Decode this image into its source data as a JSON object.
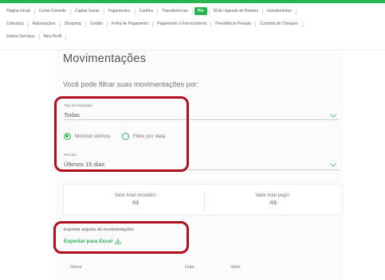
{
  "nav": {
    "row1": [
      "Página Inicial",
      "Conta Corrente",
      "Capital Social",
      "Pagamentos",
      "Cartões",
      "Transferências",
      "Pix",
      "DDA / Agenda de Boletos",
      "Investimentos"
    ],
    "row2": [
      "Cobrança",
      "Autorizações",
      "Shopping",
      "Crédito",
      "Folha de Pagamento",
      "Pagamento a Fornecedores",
      "Previdência Privada",
      "Custódia de Cheques"
    ],
    "row3": [
      "Outros Serviços",
      "Meu Perfil"
    ],
    "active": "Pix"
  },
  "page": {
    "title": "Movimentações",
    "subtitle": "Você pode filtrar suas movimentações por:"
  },
  "filters": {
    "transaction_type_label": "Tipo de transação",
    "transaction_type_value": "Todas",
    "radio_last_label": "Mostrar últimos",
    "radio_date_label": "Filtre por data",
    "radio_selected": "last",
    "period_label": "Período",
    "period_value": "Últimos 15 dias"
  },
  "totals": {
    "received_label": "Valor total recebido:",
    "received_value": "R$",
    "paid_label": "Valor total pago:",
    "paid_value": "-R$"
  },
  "export": {
    "label": "Exportar arquivo de movimentações",
    "link": "Exportar para Excel"
  },
  "table": {
    "columns": [
      "Nome",
      "Data",
      "Valor"
    ]
  },
  "colors": {
    "brand_green": "#2ab352",
    "highlight_red": "#b0101e"
  }
}
